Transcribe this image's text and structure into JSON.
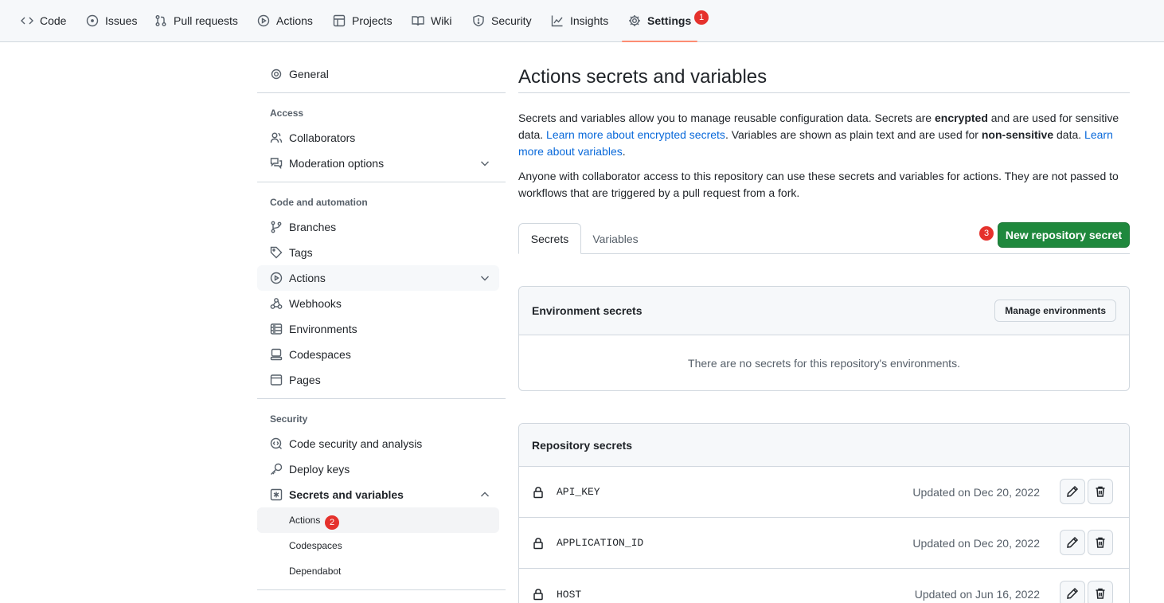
{
  "repo_nav": {
    "tabs": [
      {
        "label": "Code",
        "icon": "code-icon"
      },
      {
        "label": "Issues",
        "icon": "issue-icon"
      },
      {
        "label": "Pull requests",
        "icon": "pull-request-icon"
      },
      {
        "label": "Actions",
        "icon": "play-icon"
      },
      {
        "label": "Projects",
        "icon": "table-icon"
      },
      {
        "label": "Wiki",
        "icon": "book-icon"
      },
      {
        "label": "Security",
        "icon": "shield-icon"
      },
      {
        "label": "Insights",
        "icon": "graph-icon"
      },
      {
        "label": "Settings",
        "icon": "gear-icon"
      }
    ],
    "active_tab": "Settings",
    "settings_marker": "1"
  },
  "sidebar": {
    "general": "General",
    "sections": {
      "access": "Access",
      "code_automation": "Code and automation",
      "security": "Security"
    },
    "access_items": [
      "Collaborators",
      "Moderation options"
    ],
    "code_items": [
      "Branches",
      "Tags",
      "Actions",
      "Webhooks",
      "Environments",
      "Codespaces",
      "Pages"
    ],
    "security_items": [
      "Code security and analysis",
      "Deploy keys",
      "Secrets and variables"
    ],
    "secrets_sub_items": [
      "Actions",
      "Codespaces",
      "Dependabot"
    ],
    "actions_marker": "2"
  },
  "main": {
    "title": "Actions secrets and variables",
    "intro": {
      "p1_a": "Secrets and variables allow you to manage reusable configuration data. Secrets are ",
      "p1_b": "encrypted",
      "p1_c": " and are used for sensitive data. ",
      "p1_link1": "Learn more about encrypted secrets",
      "p1_d": ". Variables are shown as plain text and are used for ",
      "p1_e": "non-sensitive",
      "p1_f": " data. ",
      "p1_link2": "Learn more about variables",
      "p1_g": ".",
      "p2": "Anyone with collaborator access to this repository can use these secrets and variables for actions. They are not passed to workflows that are triggered by a pull request from a fork."
    },
    "tabs": [
      "Secrets",
      "Variables"
    ],
    "new_secret_button": "New repository secret",
    "new_secret_marker": "3",
    "environment_secrets": {
      "title": "Environment secrets",
      "manage_button": "Manage environments",
      "empty_text": "There are no secrets for this repository's environments."
    },
    "repository_secrets": {
      "title": "Repository secrets",
      "rows": [
        {
          "name": "API_KEY",
          "updated": "Updated on Dec 20, 2022"
        },
        {
          "name": "APPLICATION_ID",
          "updated": "Updated on Dec 20, 2022"
        },
        {
          "name": "HOST",
          "updated": "Updated on Jun 16, 2022"
        }
      ]
    }
  },
  "colors": {
    "primary_button": "#1f883d",
    "link": "#0969da",
    "active_tab_underline": "#fd8c73",
    "marker": "#e5312c"
  }
}
